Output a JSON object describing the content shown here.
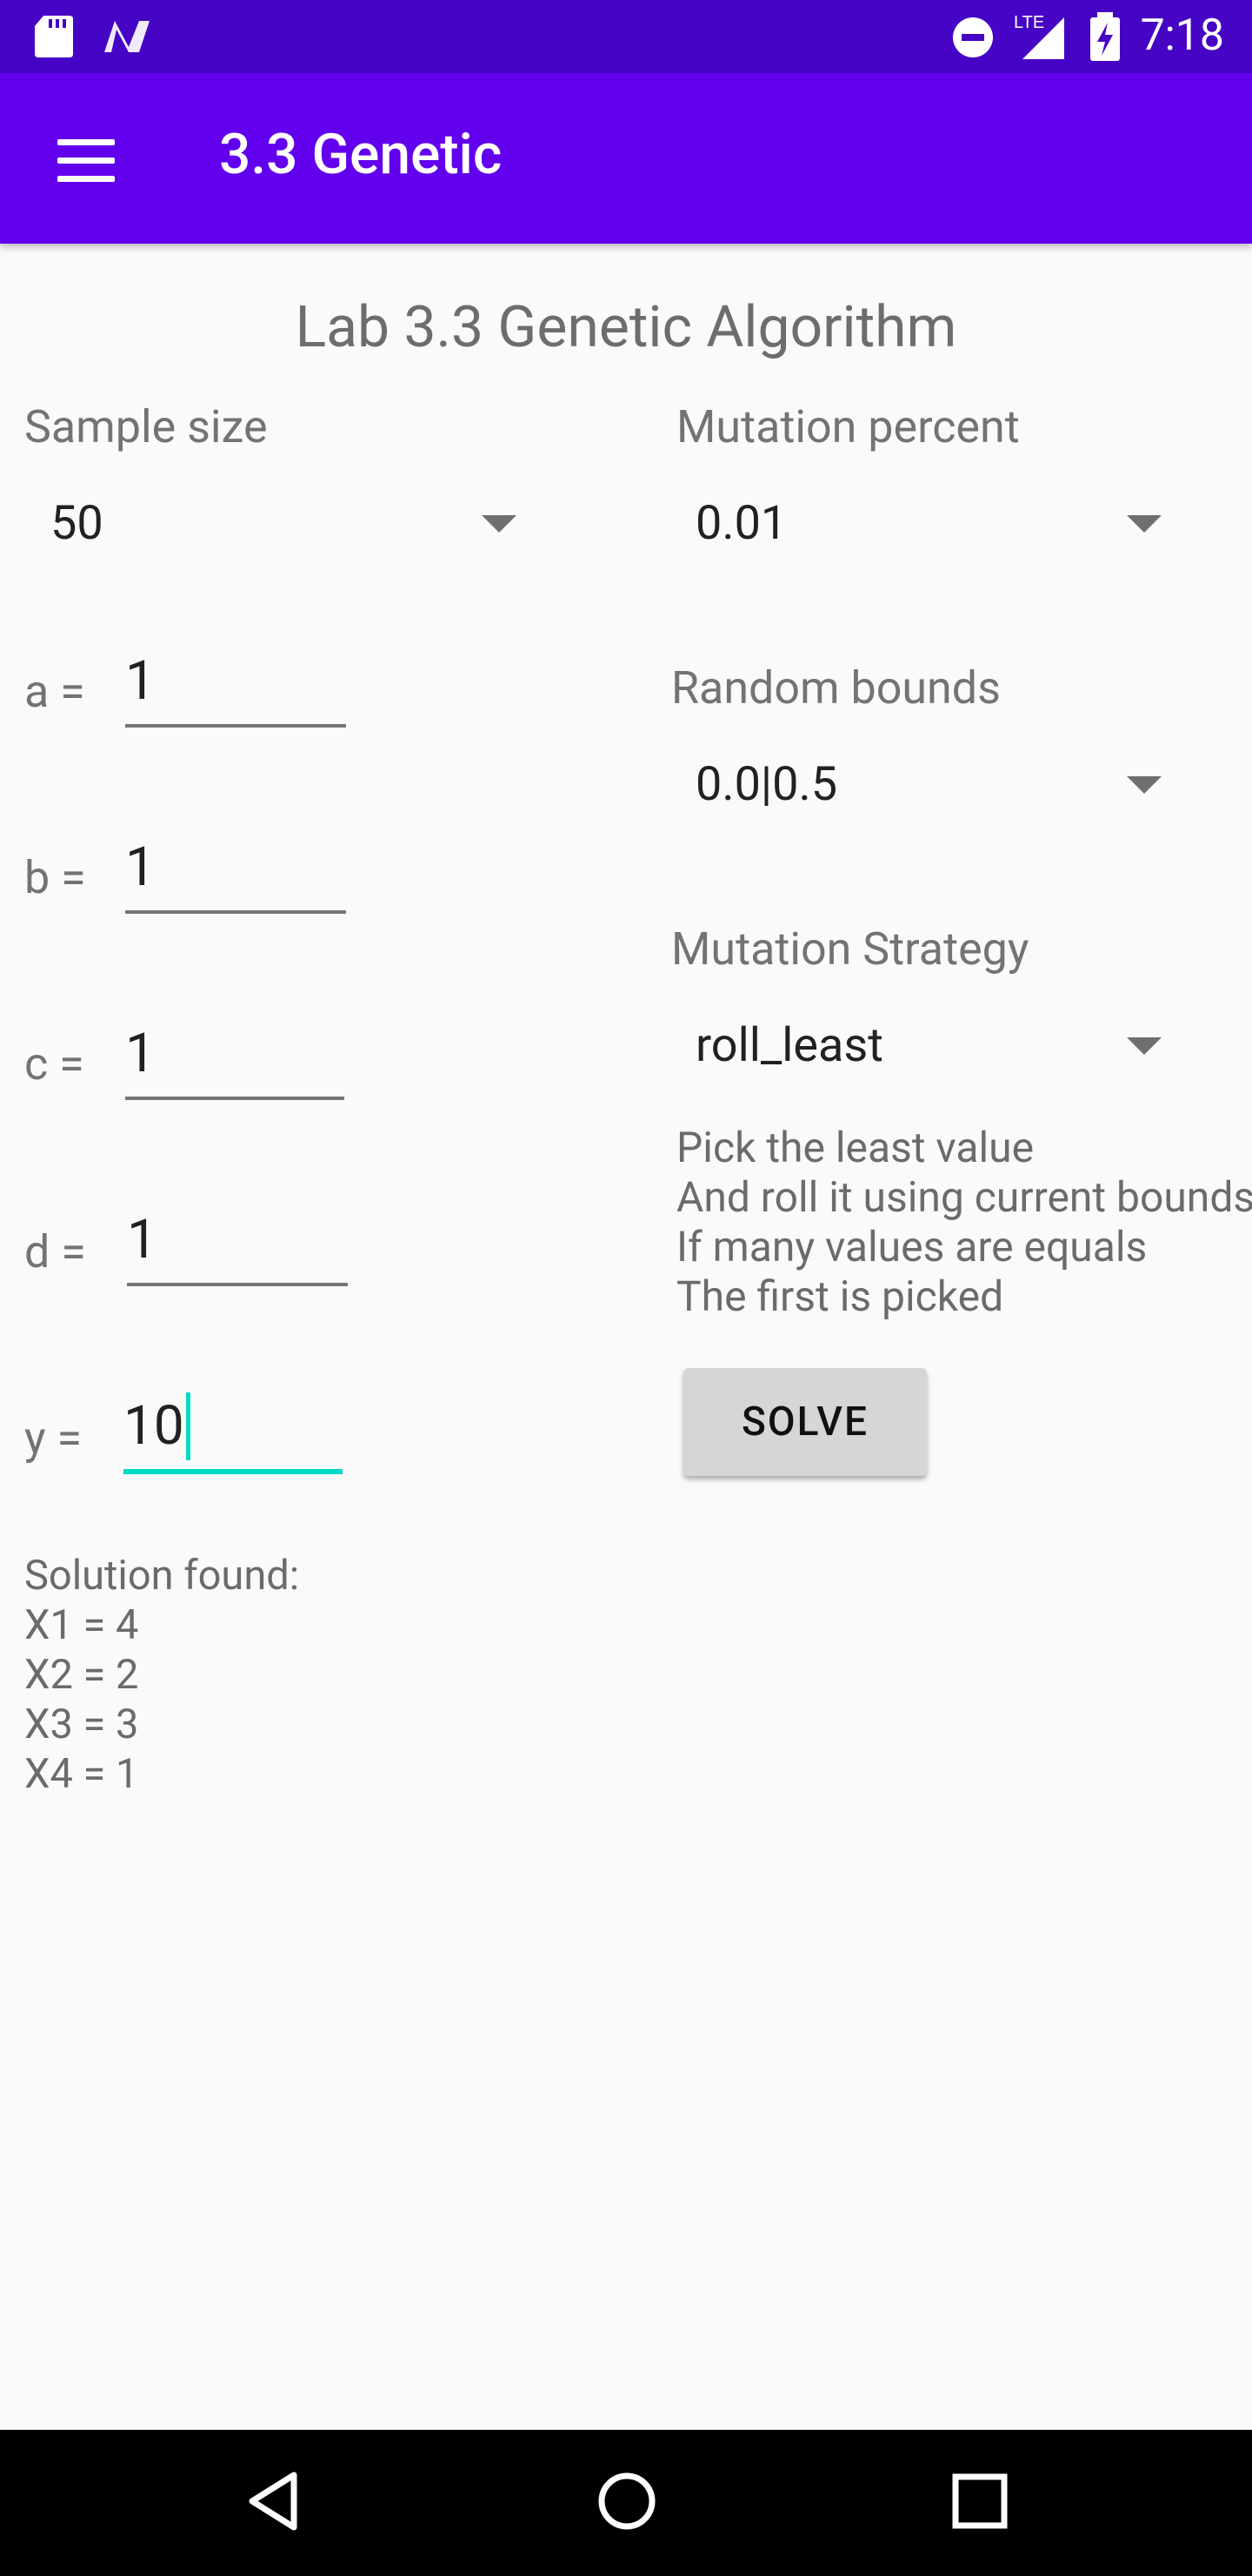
{
  "status_bar": {
    "time": "7:18",
    "network": "LTE"
  },
  "app_bar": {
    "title": "3.3 Genetic",
    "menu_icon": "hamburger-menu-icon"
  },
  "page": {
    "heading": "Lab 3.3 Genetic Algorithm"
  },
  "sample_size": {
    "label": "Sample size",
    "value": "50"
  },
  "mutation_percent": {
    "label": "Mutation percent",
    "value": "0.01"
  },
  "random_bounds": {
    "label": "Random bounds",
    "value": "0.0|0.5"
  },
  "mutation_strategy": {
    "label": "Mutation Strategy",
    "value": "roll_least",
    "description": [
      "Pick the least value",
      "And roll it using current bounds",
      "If many values are equals",
      "The first is picked"
    ]
  },
  "coefficients": [
    {
      "label": "a =",
      "value": "1"
    },
    {
      "label": "b =",
      "value": "1"
    },
    {
      "label": "c =",
      "value": "1"
    },
    {
      "label": "d =",
      "value": "1"
    },
    {
      "label": "y =",
      "value": "10"
    }
  ],
  "solve_button": {
    "label": "SOLVE"
  },
  "solution": {
    "header": "Solution found:",
    "lines": [
      "X1 = 4",
      "X2 = 2",
      "X3 = 3",
      "X4 = 1"
    ]
  },
  "colors": {
    "status_bar": "#4604c4",
    "app_bar": "#6200ee",
    "accent": "#03dac5"
  },
  "nav_icons": [
    "back-icon",
    "home-icon",
    "recents-icon"
  ]
}
